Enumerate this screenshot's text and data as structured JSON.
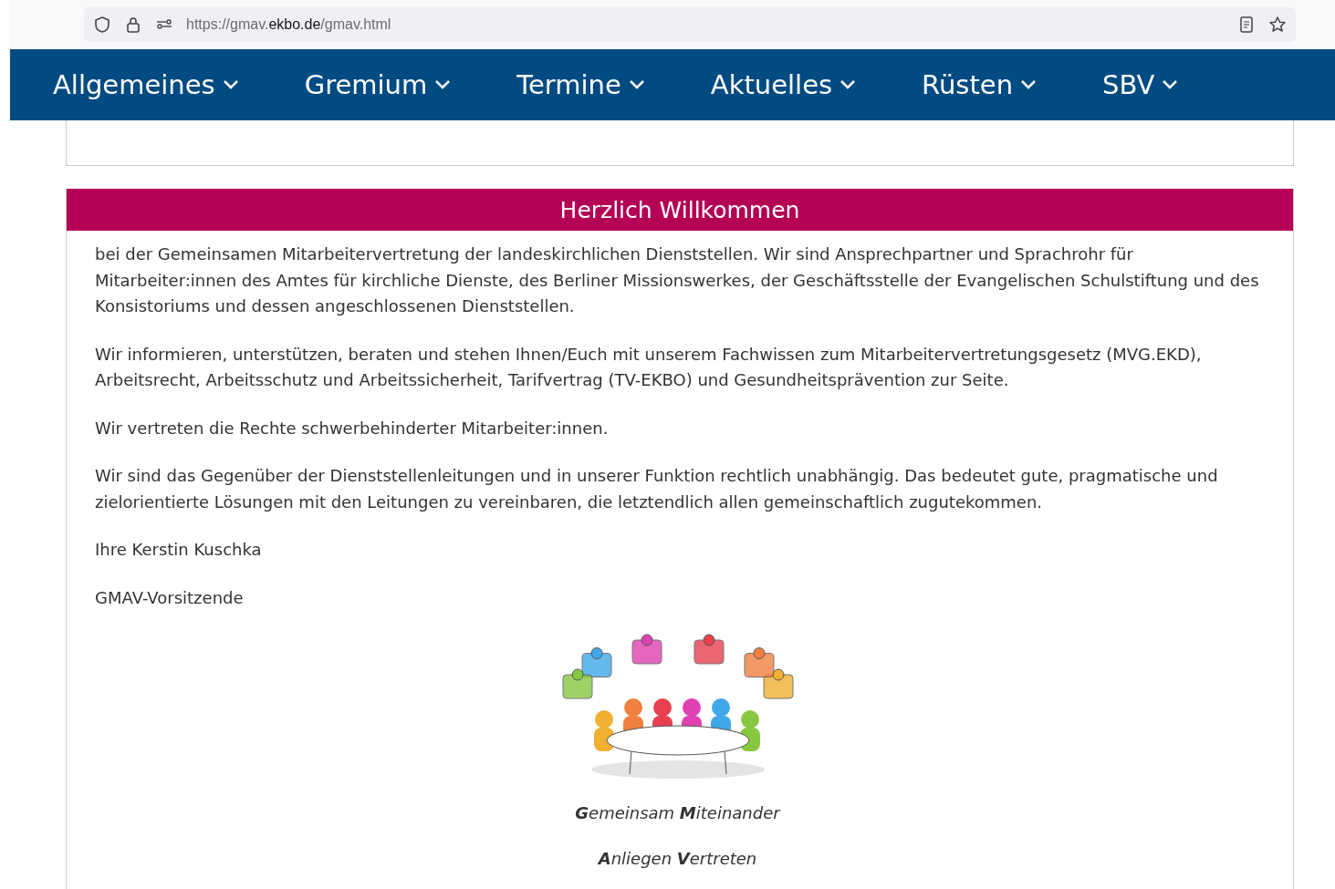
{
  "browser": {
    "url_parts": [
      "https://gmav.",
      "ekbo.de",
      "/gmav.html"
    ]
  },
  "nav": [
    {
      "label": "Allgemeines"
    },
    {
      "label": "Gremium"
    },
    {
      "label": "Termine"
    },
    {
      "label": "Aktuelles"
    },
    {
      "label": "Rüsten"
    },
    {
      "label": "SBV"
    }
  ],
  "welcome": {
    "title": "Herzlich Willkommen",
    "paragraphs": [
      "bei der Gemeinsamen Mitarbeitervertretung der landeskirchlichen Dienststellen. Wir sind Ansprechpartner und Sprachrohr für Mitarbeiter:innen des Amtes für kirchliche Dienste, des Berliner Missionswerkes, der Geschäftsstelle der Evangelischen Schulstiftung und des Konsistoriums und dessen angeschlossenen Dienststellen.",
      "Wir informieren, unterstützen, beraten und stehen Ihnen/Euch mit unserem Fachwissen zum Mitarbeitervertretungsgesetz (MVG.EKD), Arbeitsrecht, Arbeitsschutz und Arbeitssicherheit, Tarifvertrag (TV-EKBO) und Gesundheitsprävention zur Seite.",
      "Wir vertreten die Rechte schwerbehinderter Mitarbeiter:innen.",
      "Wir sind das Gegenüber der Dienststellenleitungen und in unserer Funktion rechtlich unabhängig. Das bedeutet gute, pragmatische und zielorientierte Lösungen mit den Leitungen zu vereinbaren, die letztendlich allen gemeinschaftlich zugutekommen.",
      "Ihre Kerstin Kuschka",
      "GMAV-Vorsitzende"
    ],
    "captions": [
      "**G**emeinsam **M**iteinander",
      "**A**nliegen **V**ertreten"
    ]
  }
}
